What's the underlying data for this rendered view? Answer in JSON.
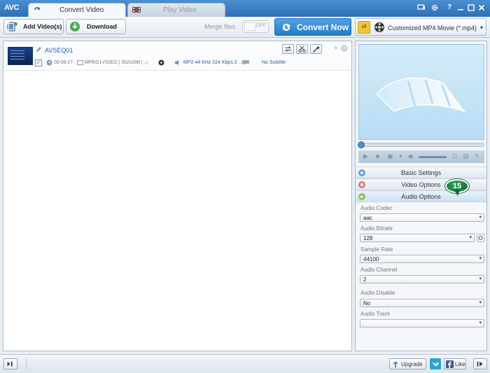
{
  "app": {
    "logo": "AVC"
  },
  "tabs": [
    {
      "label": "Convert Video",
      "active": true
    },
    {
      "label": "Play Video",
      "active": false
    }
  ],
  "window_controls": [
    "chat-icon",
    "gear-icon",
    "help-icon",
    "minimize-icon",
    "maximize-icon",
    "close-icon"
  ],
  "help_glyph": "?",
  "toolbar": {
    "add_label": "Add Video(s)",
    "download_label": "Download",
    "merge_label": "Merge files",
    "merge_state": "OFF",
    "convert_label": "Convert Now",
    "profile_badge": "all",
    "profile_label": "Customized MP4 Movie (*.mp4)",
    "chevron": "▾"
  },
  "file": {
    "name": "AVSEQ01",
    "duration": "00:08:27",
    "video_info": "MPEG1VIDEO | 352x288 | ...",
    "audio_info": "MP2 44 KHz 224 Kbps 2 ...",
    "subtitle": "No Subtitle",
    "checked": "✓",
    "add_glyph": "+",
    "close_glyph": "×"
  },
  "sections": {
    "basic": "Basic Settings",
    "video": "Video Options",
    "audio": "Audio Options"
  },
  "step_badge": "15",
  "audio": {
    "codec_label": "Audio Codec",
    "codec_value": "aac",
    "bitrate_label": "Audio Bitrate",
    "bitrate_value": "128",
    "samplerate_label": "Sample Rate",
    "samplerate_value": "44100",
    "channel_label": "Audio Channel",
    "channel_value": "2",
    "disable_label": "Audio Disable",
    "disable_value": "No",
    "track_label": "Audio Track",
    "track_value": ""
  },
  "status": {
    "upgrade_label": "Upgrade",
    "like_label": "Like"
  },
  "colors": {
    "accent": "#2d6fb5",
    "badge": "#0d6b31",
    "link": "#245fa8"
  }
}
